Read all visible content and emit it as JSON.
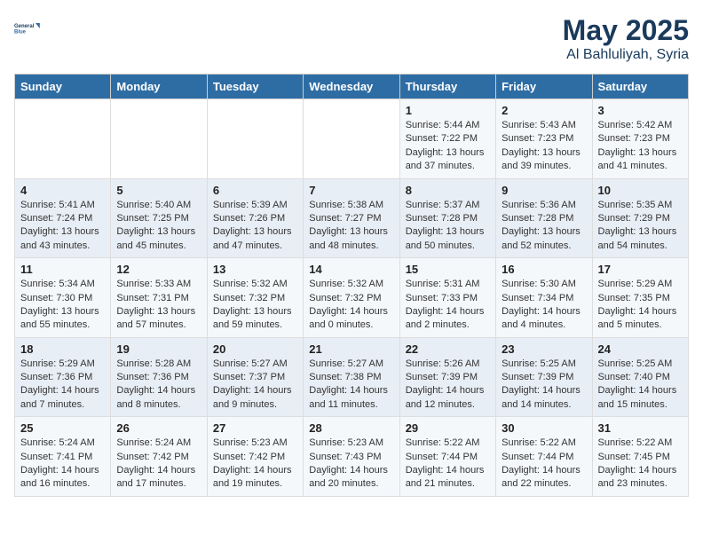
{
  "logo": {
    "line1": "General",
    "line2": "Blue"
  },
  "title": "May 2025",
  "location": "Al Bahluliyah, Syria",
  "days_of_week": [
    "Sunday",
    "Monday",
    "Tuesday",
    "Wednesday",
    "Thursday",
    "Friday",
    "Saturday"
  ],
  "weeks": [
    [
      {
        "day": "",
        "info": ""
      },
      {
        "day": "",
        "info": ""
      },
      {
        "day": "",
        "info": ""
      },
      {
        "day": "",
        "info": ""
      },
      {
        "day": "1",
        "info": "Sunrise: 5:44 AM\nSunset: 7:22 PM\nDaylight: 13 hours\nand 37 minutes."
      },
      {
        "day": "2",
        "info": "Sunrise: 5:43 AM\nSunset: 7:23 PM\nDaylight: 13 hours\nand 39 minutes."
      },
      {
        "day": "3",
        "info": "Sunrise: 5:42 AM\nSunset: 7:23 PM\nDaylight: 13 hours\nand 41 minutes."
      }
    ],
    [
      {
        "day": "4",
        "info": "Sunrise: 5:41 AM\nSunset: 7:24 PM\nDaylight: 13 hours\nand 43 minutes."
      },
      {
        "day": "5",
        "info": "Sunrise: 5:40 AM\nSunset: 7:25 PM\nDaylight: 13 hours\nand 45 minutes."
      },
      {
        "day": "6",
        "info": "Sunrise: 5:39 AM\nSunset: 7:26 PM\nDaylight: 13 hours\nand 47 minutes."
      },
      {
        "day": "7",
        "info": "Sunrise: 5:38 AM\nSunset: 7:27 PM\nDaylight: 13 hours\nand 48 minutes."
      },
      {
        "day": "8",
        "info": "Sunrise: 5:37 AM\nSunset: 7:28 PM\nDaylight: 13 hours\nand 50 minutes."
      },
      {
        "day": "9",
        "info": "Sunrise: 5:36 AM\nSunset: 7:28 PM\nDaylight: 13 hours\nand 52 minutes."
      },
      {
        "day": "10",
        "info": "Sunrise: 5:35 AM\nSunset: 7:29 PM\nDaylight: 13 hours\nand 54 minutes."
      }
    ],
    [
      {
        "day": "11",
        "info": "Sunrise: 5:34 AM\nSunset: 7:30 PM\nDaylight: 13 hours\nand 55 minutes."
      },
      {
        "day": "12",
        "info": "Sunrise: 5:33 AM\nSunset: 7:31 PM\nDaylight: 13 hours\nand 57 minutes."
      },
      {
        "day": "13",
        "info": "Sunrise: 5:32 AM\nSunset: 7:32 PM\nDaylight: 13 hours\nand 59 minutes."
      },
      {
        "day": "14",
        "info": "Sunrise: 5:32 AM\nSunset: 7:32 PM\nDaylight: 14 hours\nand 0 minutes."
      },
      {
        "day": "15",
        "info": "Sunrise: 5:31 AM\nSunset: 7:33 PM\nDaylight: 14 hours\nand 2 minutes."
      },
      {
        "day": "16",
        "info": "Sunrise: 5:30 AM\nSunset: 7:34 PM\nDaylight: 14 hours\nand 4 minutes."
      },
      {
        "day": "17",
        "info": "Sunrise: 5:29 AM\nSunset: 7:35 PM\nDaylight: 14 hours\nand 5 minutes."
      }
    ],
    [
      {
        "day": "18",
        "info": "Sunrise: 5:29 AM\nSunset: 7:36 PM\nDaylight: 14 hours\nand 7 minutes."
      },
      {
        "day": "19",
        "info": "Sunrise: 5:28 AM\nSunset: 7:36 PM\nDaylight: 14 hours\nand 8 minutes."
      },
      {
        "day": "20",
        "info": "Sunrise: 5:27 AM\nSunset: 7:37 PM\nDaylight: 14 hours\nand 9 minutes."
      },
      {
        "day": "21",
        "info": "Sunrise: 5:27 AM\nSunset: 7:38 PM\nDaylight: 14 hours\nand 11 minutes."
      },
      {
        "day": "22",
        "info": "Sunrise: 5:26 AM\nSunset: 7:39 PM\nDaylight: 14 hours\nand 12 minutes."
      },
      {
        "day": "23",
        "info": "Sunrise: 5:25 AM\nSunset: 7:39 PM\nDaylight: 14 hours\nand 14 minutes."
      },
      {
        "day": "24",
        "info": "Sunrise: 5:25 AM\nSunset: 7:40 PM\nDaylight: 14 hours\nand 15 minutes."
      }
    ],
    [
      {
        "day": "25",
        "info": "Sunrise: 5:24 AM\nSunset: 7:41 PM\nDaylight: 14 hours\nand 16 minutes."
      },
      {
        "day": "26",
        "info": "Sunrise: 5:24 AM\nSunset: 7:42 PM\nDaylight: 14 hours\nand 17 minutes."
      },
      {
        "day": "27",
        "info": "Sunrise: 5:23 AM\nSunset: 7:42 PM\nDaylight: 14 hours\nand 19 minutes."
      },
      {
        "day": "28",
        "info": "Sunrise: 5:23 AM\nSunset: 7:43 PM\nDaylight: 14 hours\nand 20 minutes."
      },
      {
        "day": "29",
        "info": "Sunrise: 5:22 AM\nSunset: 7:44 PM\nDaylight: 14 hours\nand 21 minutes."
      },
      {
        "day": "30",
        "info": "Sunrise: 5:22 AM\nSunset: 7:44 PM\nDaylight: 14 hours\nand 22 minutes."
      },
      {
        "day": "31",
        "info": "Sunrise: 5:22 AM\nSunset: 7:45 PM\nDaylight: 14 hours\nand 23 minutes."
      }
    ]
  ]
}
